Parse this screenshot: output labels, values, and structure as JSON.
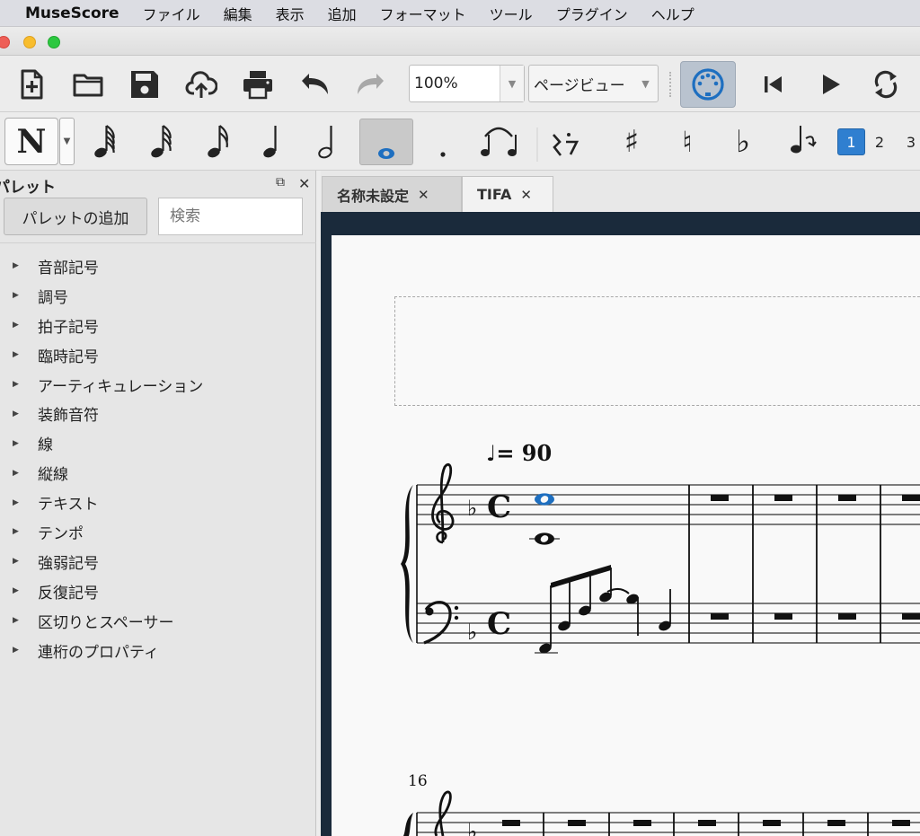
{
  "menubar": {
    "app_name": "MuseScore",
    "items": [
      "ファイル",
      "編集",
      "表示",
      "追加",
      "フォーマット",
      "ツール",
      "プラグイン",
      "ヘルプ"
    ]
  },
  "window_controls": {
    "close_color": "#ee5f57",
    "minimize_color": "#f8bd2d",
    "zoom_color": "#2cc840"
  },
  "toolbar": {
    "icons": [
      "new-file-icon",
      "open-folder-icon",
      "save-icon",
      "cloud-upload-icon",
      "print-icon",
      "undo-icon",
      "redo-icon"
    ],
    "zoom_value": "100%",
    "view_mode": "ページビュー",
    "midi_icon": "midi-input-icon",
    "playback_icons": [
      "rewind-to-start-icon",
      "play-icon",
      "loop-icon"
    ]
  },
  "note_input": {
    "mode_glyph": "N",
    "durations": [
      "64th-note-icon",
      "32nd-note-icon",
      "16th-note-icon",
      "8th-note-icon",
      "quarter-note-icon",
      "half-note-icon",
      "whole-note-icon"
    ],
    "selected_duration": "whole-note-icon",
    "augmentation_dot": ".",
    "sharp": "♯",
    "natural": "♮",
    "flat": "♭",
    "voices": [
      "1",
      "2",
      "3"
    ],
    "selected_voice": "1",
    "accent_color": "#2f7fd0"
  },
  "palette": {
    "title": "パレット",
    "add_button": "パレットの追加",
    "search_placeholder": "検索",
    "items": [
      "音部記号",
      "調号",
      "拍子記号",
      "臨時記号",
      "アーティキュレーション",
      "装飾音符",
      "線",
      "縦線",
      "テキスト",
      "テンポ",
      "強弱記号",
      "反復記号",
      "区切りとスペーサー",
      "連桁のプロパティ"
    ]
  },
  "tabs": [
    {
      "label": "名称未設定"
    },
    {
      "label": "TIFA"
    }
  ],
  "active_tab": "TIFA",
  "score": {
    "tempo_text": "♩= 90",
    "second_system_measure_number": "16",
    "time_signature": "C",
    "key_signature": "F major (1 flat)",
    "selection_color": "#1e6fc0"
  }
}
